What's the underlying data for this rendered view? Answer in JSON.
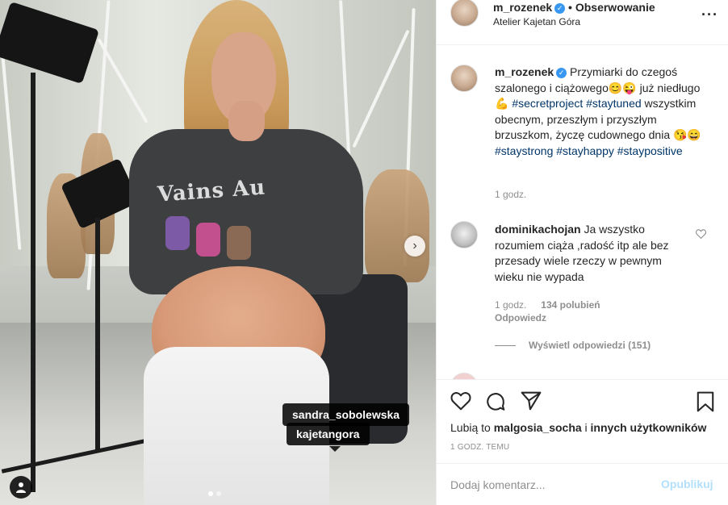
{
  "photo": {
    "tags": [
      "sandra_sobolewska",
      "kajetangora"
    ],
    "sweater_print": "Vains Au",
    "next_glyph": "›",
    "tagged_users_glyph": "👤",
    "slides": 2,
    "active_slide": 1
  },
  "header": {
    "username": "m_rozenek",
    "follow_label": "• Obserwowanie",
    "location": "Atelier Kajetan Góra",
    "more_glyph": "···"
  },
  "caption": {
    "username": "m_rozenek",
    "text_1": "Przymiarki do czegoś szalonego i ciążowego",
    "emoji_1": "😊😜",
    "text_2": " już niedługo ",
    "emoji_2": "💪",
    "hashtags_1": "#secretproject #staytuned",
    "text_3": " wszystkim obecnym, przeszłym i przyszłym brzuszkom, życzę cudownego dnia ",
    "emoji_3": "😘😄",
    "hashtags_2": "#staystrong #stayhappy #staypositive",
    "time": "1 godz."
  },
  "comment": {
    "username": "dominikachojan",
    "text": "Ja wszystko rozumiem ciąża ,radość itp ale bez przesady wiele rzeczy w pewnym wieku nie wypada",
    "time": "1 godz.",
    "likes": "134 polubień",
    "reply": "Odpowiedz",
    "view_replies": "Wyświetl odpowiedzi (151)"
  },
  "likes": {
    "prefix": "Lubią to ",
    "user": "malgosia_socha",
    "middle": " i ",
    "others": "innych użytkowników"
  },
  "timestamp": "1 GODZ. TEMU",
  "add_comment": {
    "placeholder": "Dodaj komentarz...",
    "publish": "Opublikuj"
  },
  "colors": {
    "link_blue": "#003569",
    "verified_blue": "#3897f0",
    "publish_disabled": "#b2dffc",
    "meta_gray": "#8e8e8e"
  }
}
